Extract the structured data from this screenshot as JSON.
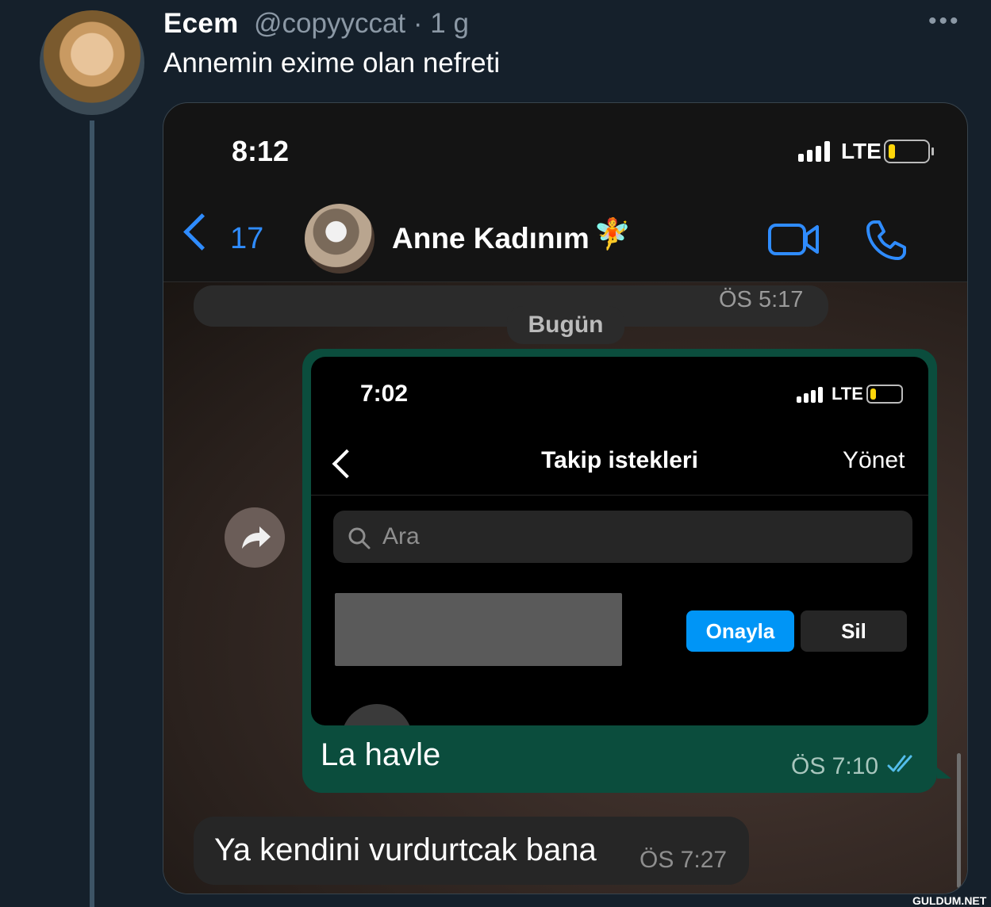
{
  "tweet": {
    "author_name": "Ecem",
    "handle_time": "@copyyccat · 1 g",
    "more": "•••",
    "text": "Annemin exime olan nefreti"
  },
  "phone": {
    "time": "8:12",
    "network": "LTE",
    "battery_level": 0.12,
    "battery_color": "#ffd60a",
    "chat": {
      "back_count": "17",
      "contact_name": "Anne Kadınım",
      "contact_emoji": "🧚",
      "accent": "#2f8cff",
      "prev_time": "ÖS 5:17",
      "date_label": "Bugün",
      "sent_message": {
        "text": "La havle",
        "time": "ÖS 7:10",
        "bubble_color": "#0b4d3d"
      },
      "received_message": {
        "text": "Ya kendini vurdurtcak bana",
        "time": "ÖS 7:27"
      }
    },
    "embedded_screenshot": {
      "time": "7:02",
      "network": "LTE",
      "title": "Takip istekleri",
      "manage": "Yönet",
      "search_placeholder": "Ara",
      "approve": "Onayla",
      "delete": "Sil",
      "approve_color": "#0095f6"
    }
  },
  "watermark": "GULDUM.NET"
}
